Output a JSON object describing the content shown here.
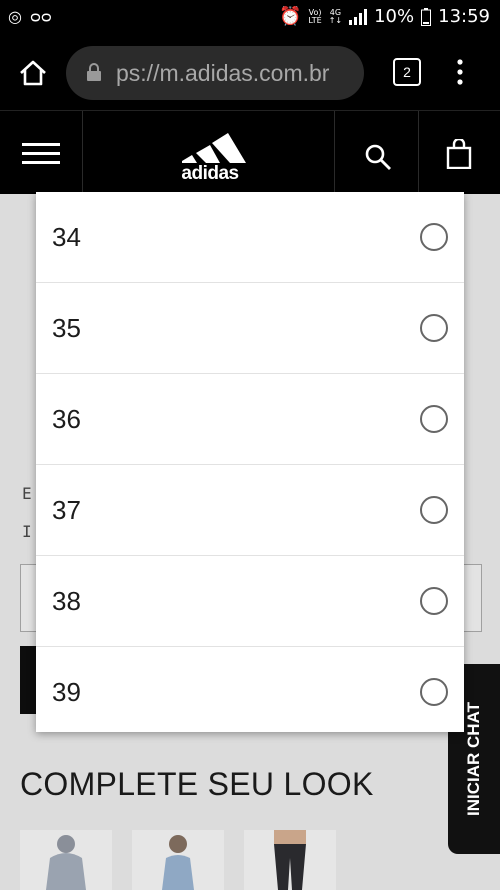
{
  "status_bar": {
    "volte_top": "Vo)",
    "volte_bottom": "LTE",
    "network_top": "4G",
    "network_bottom": "↑↓",
    "battery": "10%",
    "time": "13:59"
  },
  "browser": {
    "url": "ps://m.adidas.com.br",
    "tab_count": "2"
  },
  "site_header": {
    "logo_text": "adidas"
  },
  "page": {
    "section_title": "COMPLETE SEU LOOK",
    "chat_label": "INICIAR CHAT"
  },
  "size_dialog": {
    "options": [
      {
        "label": "34",
        "selected": false
      },
      {
        "label": "35",
        "selected": false
      },
      {
        "label": "36",
        "selected": false
      },
      {
        "label": "37",
        "selected": false
      },
      {
        "label": "38",
        "selected": false
      },
      {
        "label": "39",
        "selected": false
      }
    ]
  }
}
